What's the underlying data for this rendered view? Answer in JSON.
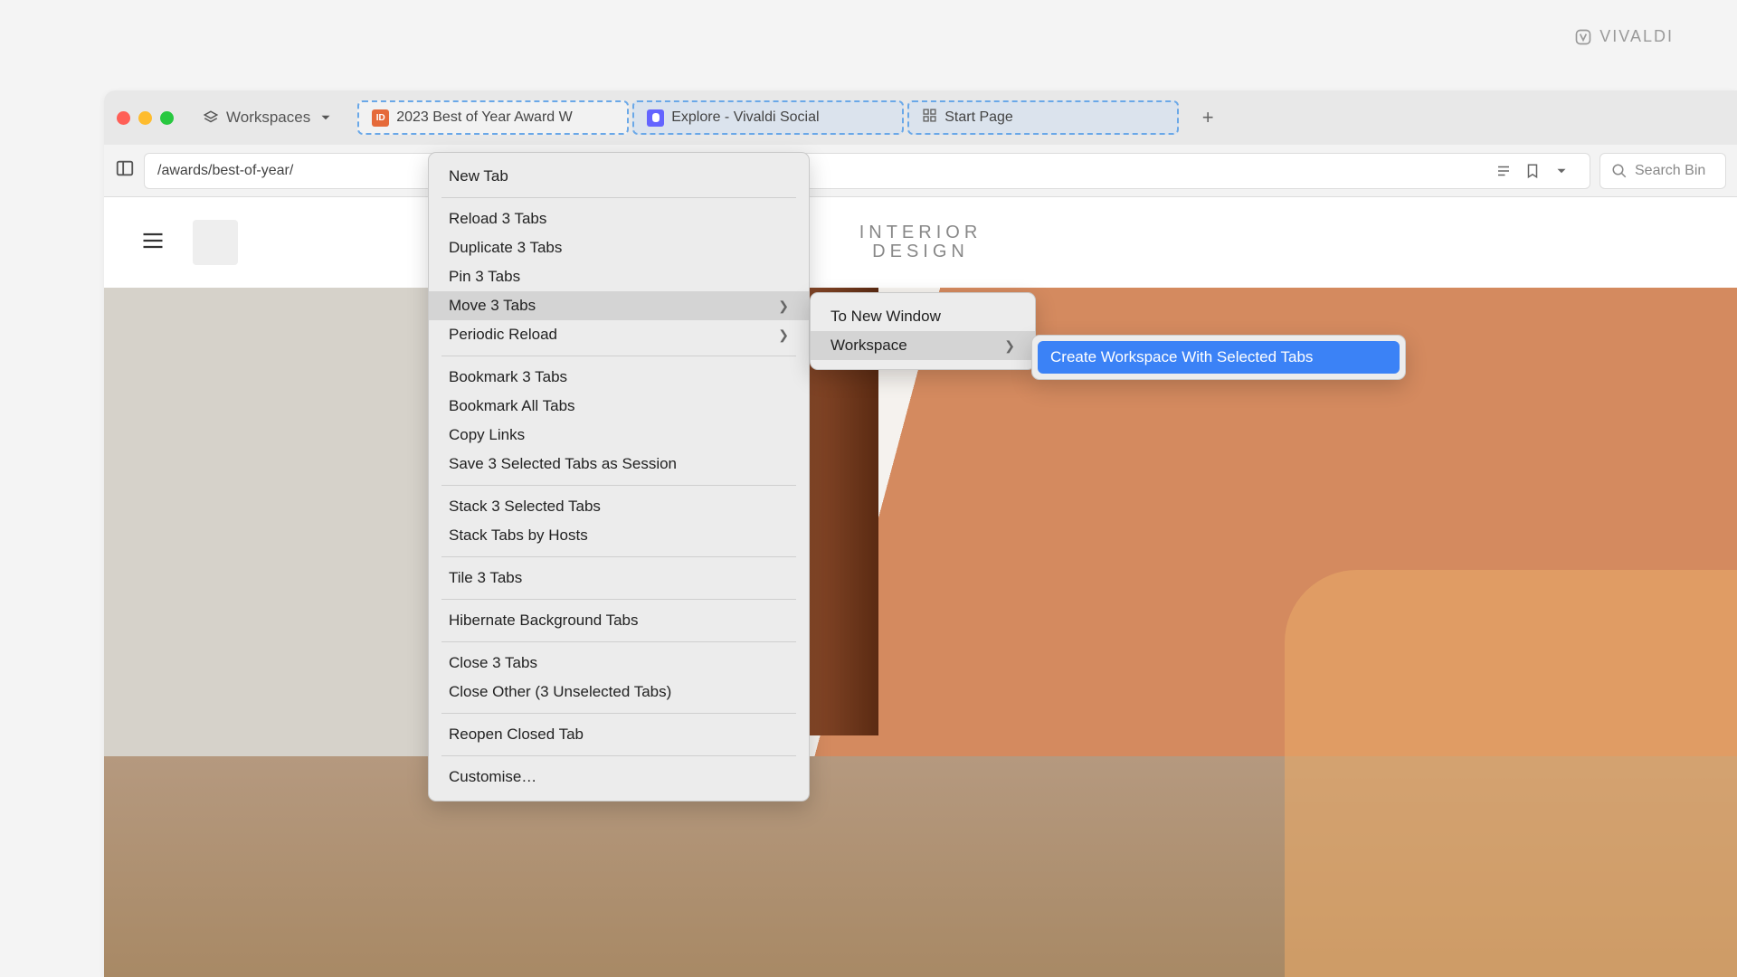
{
  "logo": "VIVALDI",
  "workspaces_label": "Workspaces",
  "tabs": [
    {
      "title": "2023 Best of Year Award W",
      "favicon": "ID"
    },
    {
      "title": "Explore - Vivaldi Social",
      "favicon": "mastodon"
    },
    {
      "title": "Start Page",
      "favicon": "startpage"
    }
  ],
  "url": "/awards/best-of-year/",
  "search_placeholder": "Search Bin",
  "brand_line1": "INTERIOR",
  "brand_line2": "DESIGN",
  "context_menu": {
    "new_tab": "New Tab",
    "reload": "Reload 3 Tabs",
    "duplicate": "Duplicate 3 Tabs",
    "pin": "Pin 3 Tabs",
    "move": "Move 3 Tabs",
    "periodic": "Periodic Reload",
    "bookmark3": "Bookmark 3 Tabs",
    "bookmark_all": "Bookmark All Tabs",
    "copy_links": "Copy Links",
    "save_session": "Save 3 Selected Tabs as Session",
    "stack_sel": "Stack 3 Selected Tabs",
    "stack_host": "Stack Tabs by Hosts",
    "tile": "Tile 3 Tabs",
    "hibernate": "Hibernate Background Tabs",
    "close3": "Close 3 Tabs",
    "close_other": "Close Other (3 Unselected Tabs)",
    "reopen": "Reopen Closed Tab",
    "customise": "Customise…"
  },
  "submenu1": {
    "to_new_window": "To New Window",
    "workspace": "Workspace"
  },
  "submenu2": {
    "create": "Create Workspace With Selected Tabs"
  }
}
